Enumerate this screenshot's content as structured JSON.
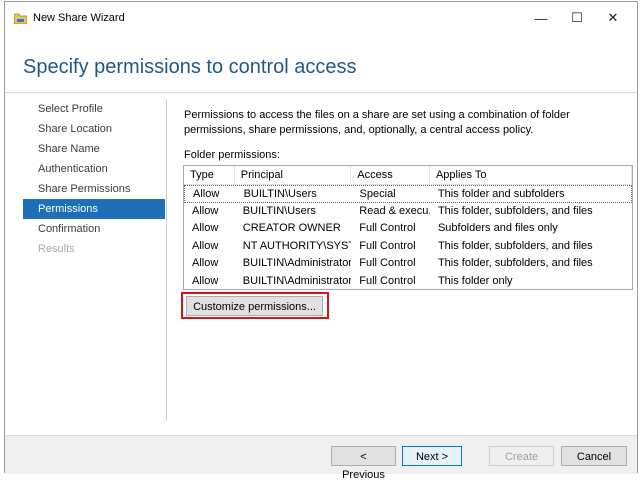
{
  "window": {
    "title": "New Share Wizard",
    "controls": {
      "minimize": "—",
      "maximize": "☐",
      "close": "✕"
    }
  },
  "page_title": "Specify permissions to control access",
  "nav": {
    "items": [
      {
        "label": "Select Profile",
        "state": "normal"
      },
      {
        "label": "Share Location",
        "state": "normal"
      },
      {
        "label": "Share Name",
        "state": "normal"
      },
      {
        "label": "Authentication",
        "state": "normal"
      },
      {
        "label": "Share Permissions",
        "state": "normal"
      },
      {
        "label": "Permissions",
        "state": "active"
      },
      {
        "label": "Confirmation",
        "state": "normal"
      },
      {
        "label": "Results",
        "state": "disabled"
      }
    ]
  },
  "intro_text": "Permissions to access the files on a share are set using a combination of folder permissions, share permissions, and, optionally, a central access policy.",
  "folder_permissions": {
    "label": "Folder permissions:",
    "columns": [
      "Type",
      "Principal",
      "Access",
      "Applies To"
    ],
    "rows": [
      [
        "Allow",
        "BUILTIN\\Users",
        "Special",
        "This folder and subfolders"
      ],
      [
        "Allow",
        "BUILTIN\\Users",
        "Read & execu...",
        "This folder, subfolders, and files"
      ],
      [
        "Allow",
        "CREATOR OWNER",
        "Full Control",
        "Subfolders and files only"
      ],
      [
        "Allow",
        "NT AUTHORITY\\SYSTEM",
        "Full Control",
        "This folder, subfolders, and files"
      ],
      [
        "Allow",
        "BUILTIN\\Administrators",
        "Full Control",
        "This folder, subfolders, and files"
      ],
      [
        "Allow",
        "BUILTIN\\Administrators",
        "Full Control",
        "This folder only"
      ]
    ]
  },
  "buttons": {
    "customize": "Customize permissions...",
    "previous": "< Previous",
    "next": "Next >",
    "create": "Create",
    "cancel": "Cancel"
  },
  "colors": {
    "title": "#1e5a87",
    "nav_active": "#1f6fb6",
    "highlight": "#d7141a"
  },
  "icons": {
    "app": "share-folder-icon"
  }
}
